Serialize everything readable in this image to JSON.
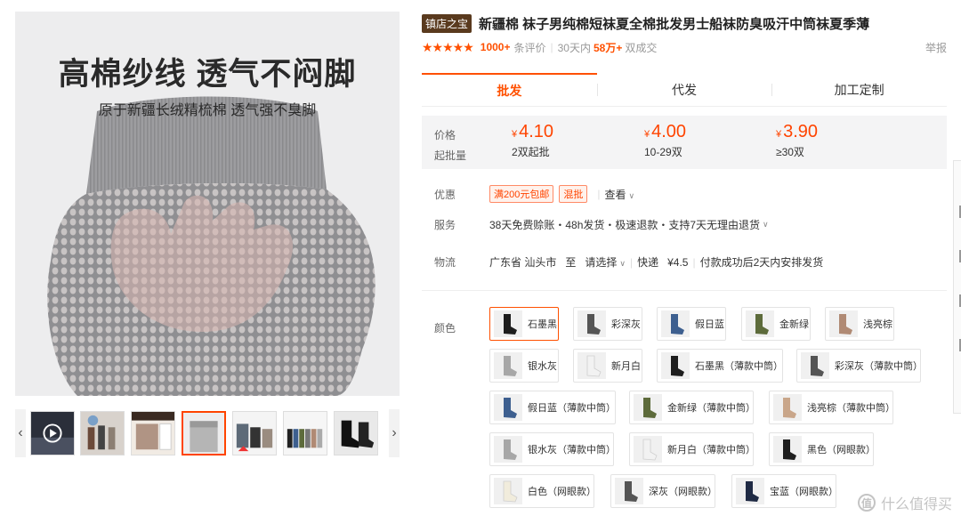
{
  "gallery": {
    "headline": "高棉纱线 透气不闷脚",
    "subheadline": "原于新疆长绒精梳棉 透气强不臭脚",
    "prev_icon": "chevron-left-icon",
    "next_icon": "chevron-right-icon",
    "thumbnails": [
      {
        "label": "视频",
        "color": "#2b2f3a"
      },
      {
        "label": "",
        "color": "#8c7f73"
      },
      {
        "label": "",
        "color": "#6b4a3a"
      },
      {
        "label": "",
        "color": "#b5b5b5"
      },
      {
        "label": "",
        "color": "#5d6a78"
      },
      {
        "label": "",
        "color": "#444444"
      },
      {
        "label": "",
        "color": "#e9e9e9"
      }
    ]
  },
  "product": {
    "shop_tag": "镇店之宝",
    "title": "新疆棉 袜子男纯棉短袜夏全棉批发男士船袜防臭吸汗中筒袜夏季薄",
    "rating_stars": "★★★★★",
    "reviews_count": "1000+",
    "reviews_label": "条评价",
    "period_label": "30天内",
    "sold_count": "58万+",
    "sold_label": "双成交",
    "report_label": "举报"
  },
  "mode_tabs": [
    {
      "label": "批发",
      "active": true
    },
    {
      "label": "代发",
      "active": false
    },
    {
      "label": "加工定制",
      "active": false
    }
  ],
  "price": {
    "price_label": "价格",
    "qty_label": "起批量",
    "currency": "¥",
    "tiers": [
      {
        "price": "4.10",
        "qty": "2双起批"
      },
      {
        "price": "4.00",
        "qty": "10-29双"
      },
      {
        "price": "3.90",
        "qty": "≥30双"
      }
    ]
  },
  "promo": {
    "label": "优惠",
    "badges": [
      "满200元包邮",
      "混批"
    ],
    "more": "查看"
  },
  "service": {
    "label": "服务",
    "text": "38天免费赊账・48h发货・极速退款・支持7天无理由退货"
  },
  "logistics": {
    "label": "物流",
    "from": "广东省 汕头市",
    "to_label": "至",
    "select": "请选择",
    "shipping_label": "快递",
    "shipping_fee": "¥4.5",
    "dispatch": "付款成功后2天内安排发货"
  },
  "colors": {
    "label": "颜色",
    "options": [
      {
        "name": "石墨黑",
        "sock": "#1e1e1e",
        "selected": true
      },
      {
        "name": "彩深灰",
        "sock": "#555555",
        "selected": false
      },
      {
        "name": "假日蓝",
        "sock": "#3d5f8f",
        "selected": false
      },
      {
        "name": "金新绿",
        "sock": "#5d6b3b",
        "selected": false
      },
      {
        "name": "浅亮棕",
        "sock": "#b08a74",
        "selected": false
      },
      {
        "name": "银水灰",
        "sock": "#a7a7a7",
        "selected": false
      },
      {
        "name": "新月白",
        "sock": "#f2f2f2",
        "selected": false
      },
      {
        "name": "石墨黑（薄款中筒）",
        "sock": "#1e1e1e",
        "selected": false
      },
      {
        "name": "彩深灰（薄款中筒）",
        "sock": "#555555",
        "selected": false
      },
      {
        "name": "假日蓝（薄款中筒）",
        "sock": "#3d5f8f",
        "selected": false
      },
      {
        "name": "金新绿（薄款中筒）",
        "sock": "#5d6b3b",
        "selected": false
      },
      {
        "name": "浅亮棕（薄款中筒）",
        "sock": "#c9a68a",
        "selected": false
      },
      {
        "name": "银水灰（薄款中筒）",
        "sock": "#a7a7a7",
        "selected": false
      },
      {
        "name": "新月白（薄款中筒）",
        "sock": "#f2f2f2",
        "selected": false
      },
      {
        "name": "黑色（网眼款）",
        "sock": "#1e1e1e",
        "selected": false
      },
      {
        "name": "白色（网眼款）",
        "sock": "#f1ecdc",
        "selected": false
      },
      {
        "name": "深灰（网眼款）",
        "sock": "#555555",
        "selected": false
      },
      {
        "name": "宝蓝（网眼款）",
        "sock": "#1f2a44",
        "selected": false
      }
    ]
  },
  "watermark": {
    "logo_text": "值",
    "text": "什么值得买"
  },
  "theme": {
    "accent": "#ff5000",
    "price": "#ff4400"
  }
}
